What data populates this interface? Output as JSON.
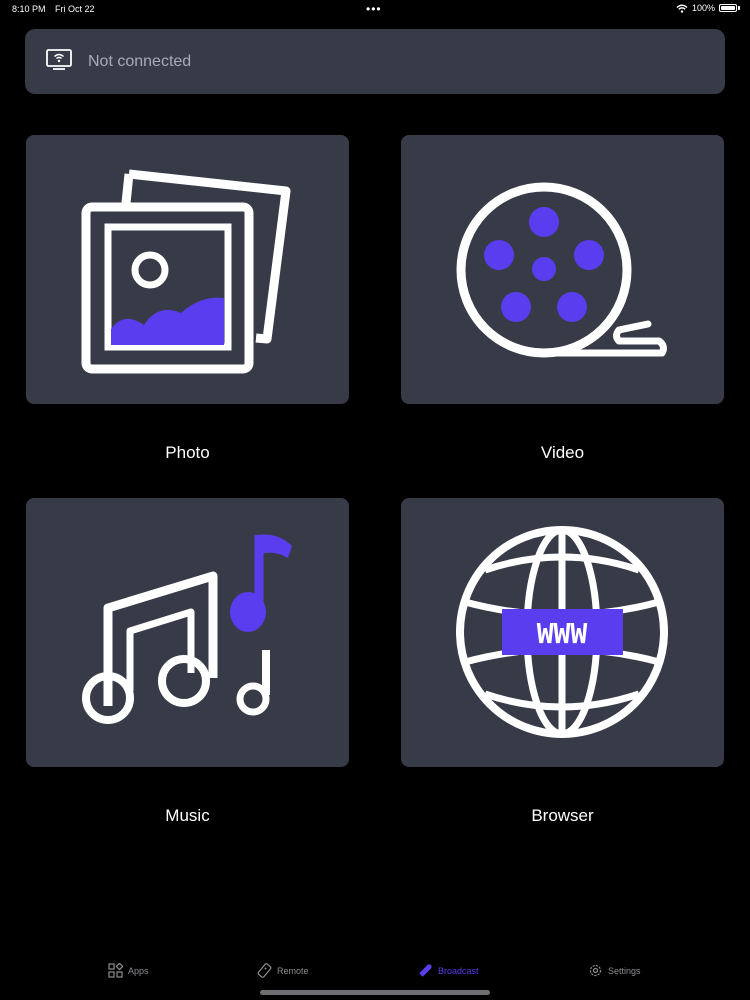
{
  "status_bar": {
    "time": "8:10 PM",
    "date": "Fri Oct 22",
    "battery": "100%",
    "icons": [
      "wifi-icon",
      "battery-icon"
    ]
  },
  "connection": {
    "status_text": "Not connected",
    "icon": "cast-screen-icon"
  },
  "tiles": [
    {
      "label": "Photo",
      "icon": "photo-icon"
    },
    {
      "label": "Video",
      "icon": "film-reel-icon"
    },
    {
      "label": "Music",
      "icon": "music-notes-icon"
    },
    {
      "label": "Browser",
      "icon": "globe-www-icon"
    }
  ],
  "browser_badge": "WWW",
  "tab_bar": {
    "items": [
      {
        "label": "Apps",
        "icon": "apps-grid-icon"
      },
      {
        "label": "Remote",
        "icon": "remote-icon"
      },
      {
        "label": "Broadcast",
        "icon": "broadcast-icon"
      },
      {
        "label": "Settings",
        "icon": "gear-icon"
      }
    ],
    "active": "Broadcast"
  },
  "colors": {
    "accent": "#5b3df0",
    "tile_bg": "#373a47",
    "background": "#000000",
    "muted_text": "#a8abb5"
  }
}
